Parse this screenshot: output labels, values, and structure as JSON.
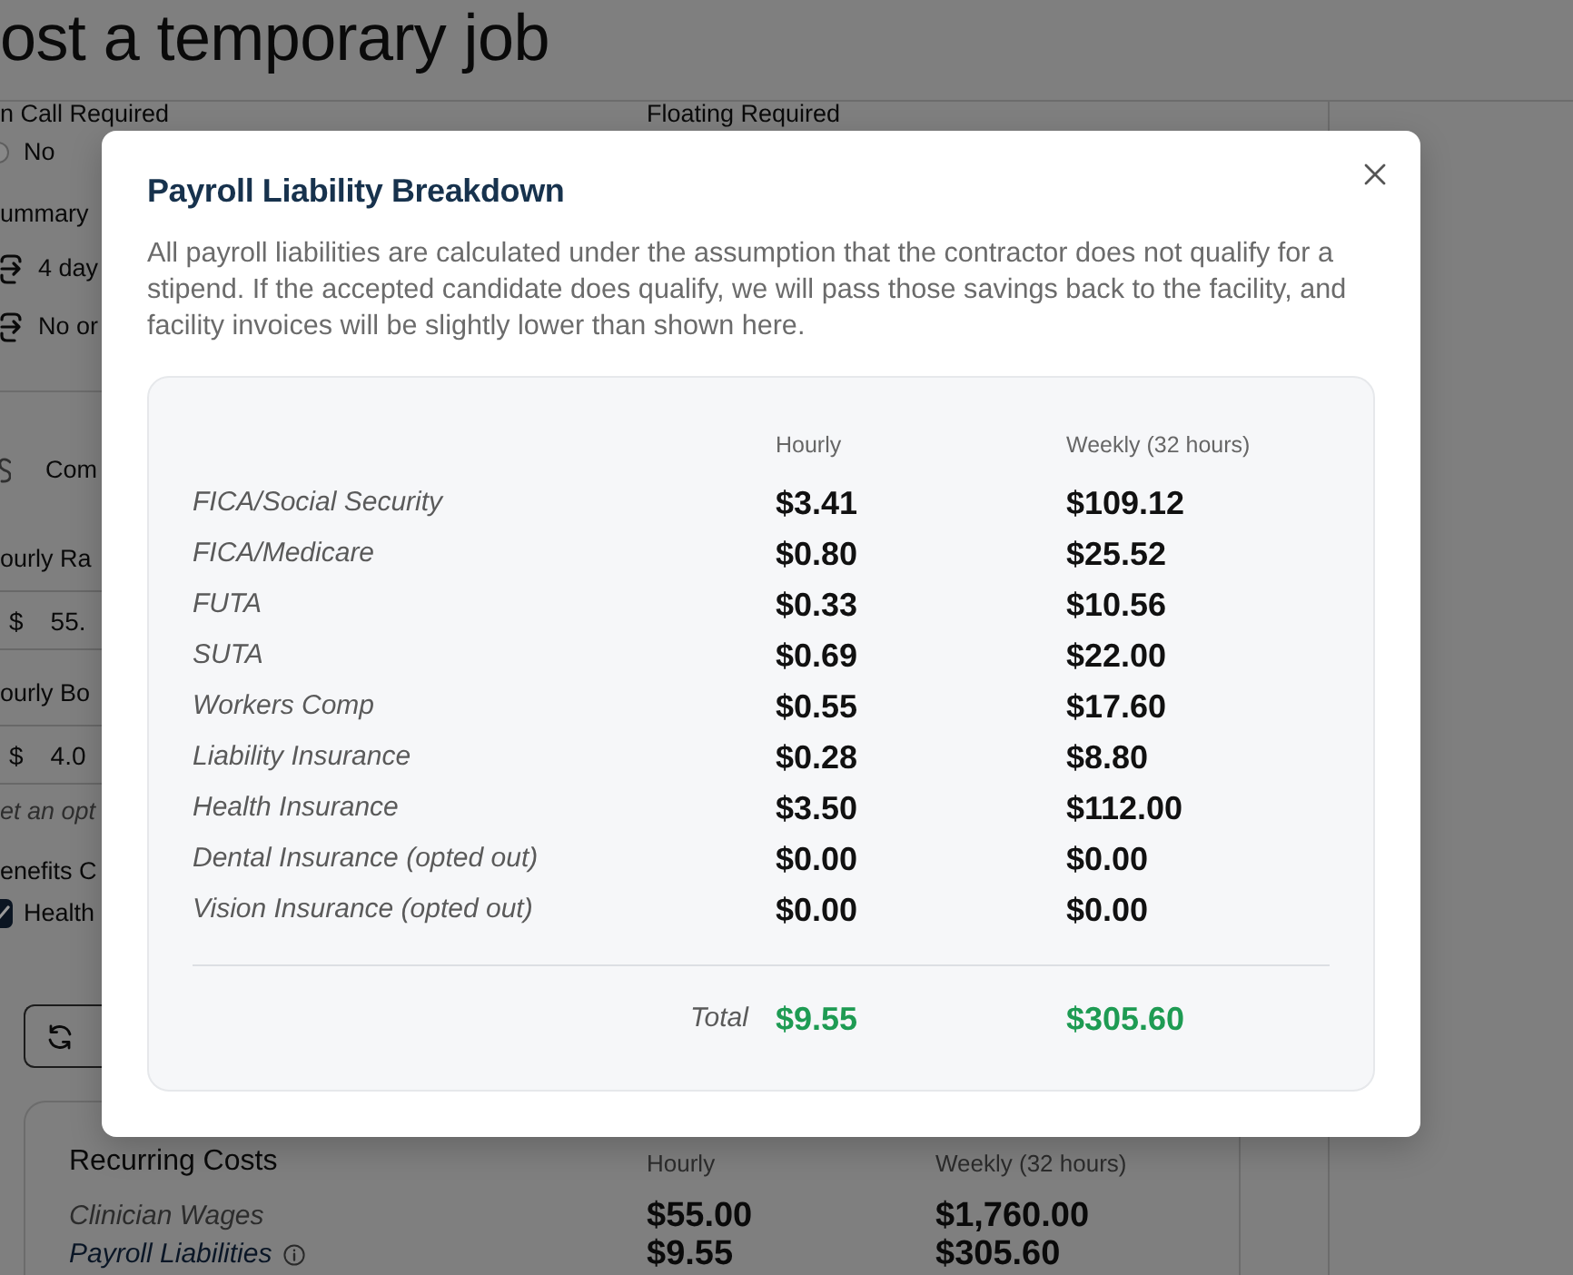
{
  "page": {
    "title": "ost a temporary job"
  },
  "form": {
    "top_labels": [
      "n Call Required",
      "Floating Required"
    ],
    "on_call": {
      "options": [
        {
          "label": "No",
          "selected": false
        }
      ]
    },
    "summary": {
      "heading": "ummary",
      "items": [
        "4 day",
        "No or"
      ]
    },
    "compensation": {
      "heading": "Com",
      "fields": [
        {
          "label": "ourly Ra",
          "prefix": "$",
          "value": "55."
        },
        {
          "label": "ourly Bo",
          "prefix": "$",
          "value": "4.0"
        }
      ],
      "hint": "et an opt"
    },
    "benefits": {
      "heading": "enefits C",
      "options": [
        {
          "label": "Health",
          "checked": true
        }
      ]
    }
  },
  "recurring_costs": {
    "title": "Recurring Costs",
    "columns": [
      "Hourly",
      "Weekly (32 hours)"
    ],
    "rows": [
      {
        "kind": "text",
        "label": "Clinician Wages",
        "hourly": "$55.00",
        "weekly": "$1,760.00"
      },
      {
        "kind": "link",
        "label": "Payroll Liabilities",
        "hourly": "$9.55",
        "weekly": "$305.60"
      }
    ]
  },
  "modal": {
    "title": "Payroll Liability Breakdown",
    "description": "All payroll liabilities are calculated under the assumption that the contractor does not qualify for a stipend. If the accepted candidate does qualify, we will pass those savings back to the facility, and facility invoices will be slightly lower than shown here.",
    "columns": [
      "Hourly",
      "Weekly (32 hours)"
    ],
    "rows": [
      {
        "label": "FICA/Social Security",
        "hourly": "$3.41",
        "weekly": "$109.12"
      },
      {
        "label": "FICA/Medicare",
        "hourly": "$0.80",
        "weekly": "$25.52"
      },
      {
        "label": "FUTA",
        "hourly": "$0.33",
        "weekly": "$10.56"
      },
      {
        "label": "SUTA",
        "hourly": "$0.69",
        "weekly": "$22.00"
      },
      {
        "label": "Workers Comp",
        "hourly": "$0.55",
        "weekly": "$17.60"
      },
      {
        "label": "Liability Insurance",
        "hourly": "$0.28",
        "weekly": "$8.80"
      },
      {
        "label": "Health Insurance",
        "hourly": "$3.50",
        "weekly": "$112.00"
      },
      {
        "label": "Dental Insurance (opted out)",
        "hourly": "$0.00",
        "weekly": "$0.00"
      },
      {
        "label": "Vision Insurance (opted out)",
        "hourly": "$0.00",
        "weekly": "$0.00"
      }
    ],
    "total": {
      "label": "Total",
      "hourly": "$9.55",
      "weekly": "$305.60"
    }
  }
}
